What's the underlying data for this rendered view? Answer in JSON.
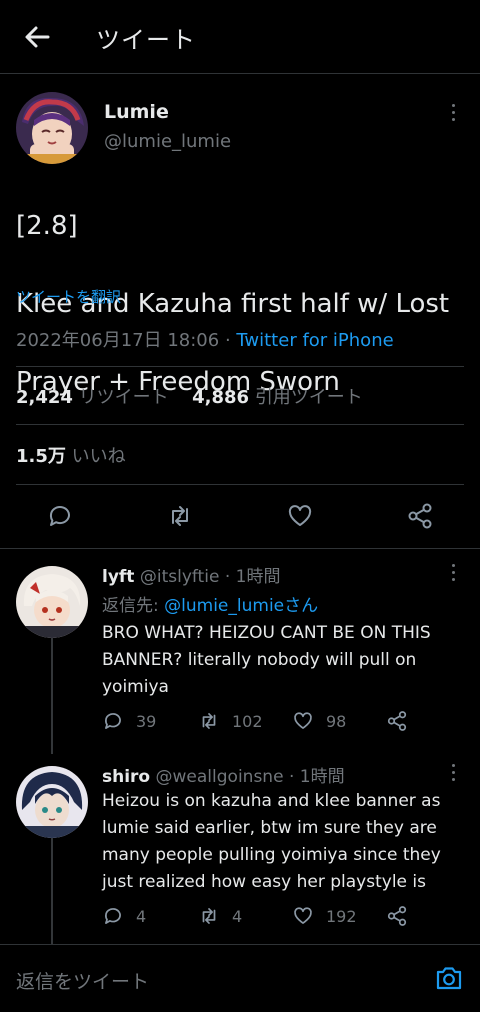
{
  "header": {
    "title": "ツイート"
  },
  "main_tweet": {
    "name": "Lumie",
    "handle": "@lumie_lumie",
    "lines": [
      "[2.8]",
      "Klee and Kazuha first half w/ Lost",
      "Prayer + Freedom Sworn"
    ],
    "translate": "ツイートを翻訳",
    "datetime": "2022年06月17日 18:06",
    "separator": " · ",
    "source": "Twitter for iPhone",
    "retweets_count": "2,424",
    "retweets_label": "リツイート",
    "quotes_count": "4,886",
    "quotes_label": "引用ツイート",
    "likes_count": "1.5万",
    "likes_label": "いいね"
  },
  "replies": [
    {
      "name": "lyft",
      "handle": "@itslyftie",
      "time": " · 1時間",
      "reply_to_prefix": "返信先: ",
      "reply_to_handle": "@lumie_lumie",
      "reply_to_suffix": "さん",
      "text": "BRO WHAT? HEIZOU CANT BE ON THIS BANNER? literally nobody will pull on yoimiya",
      "reply_count": "39",
      "retweet_count": "102",
      "like_count": "98"
    },
    {
      "name": "shiro",
      "handle": "@weallgoinsne",
      "time": " · 1時間",
      "text": "Heizou is on kazuha and klee banner as lumie said earlier, btw im sure they are many people pulling yoimiya since they just realized how easy her playstyle is",
      "reply_count": "4",
      "retweet_count": "4",
      "like_count": "192"
    }
  ],
  "compose": {
    "placeholder": "返信をツイート"
  },
  "icons": {
    "back": "arrow-left-icon",
    "reply": "speech-bubble-icon",
    "retweet": "retweet-arrows-icon",
    "like": "heart-icon",
    "share": "share-icon",
    "more": "vertical-dots-icon",
    "camera": "camera-icon"
  },
  "colors": {
    "accent": "#1d9bf0",
    "muted": "#71767b",
    "text": "#e7e9ea",
    "background": "#000000"
  }
}
